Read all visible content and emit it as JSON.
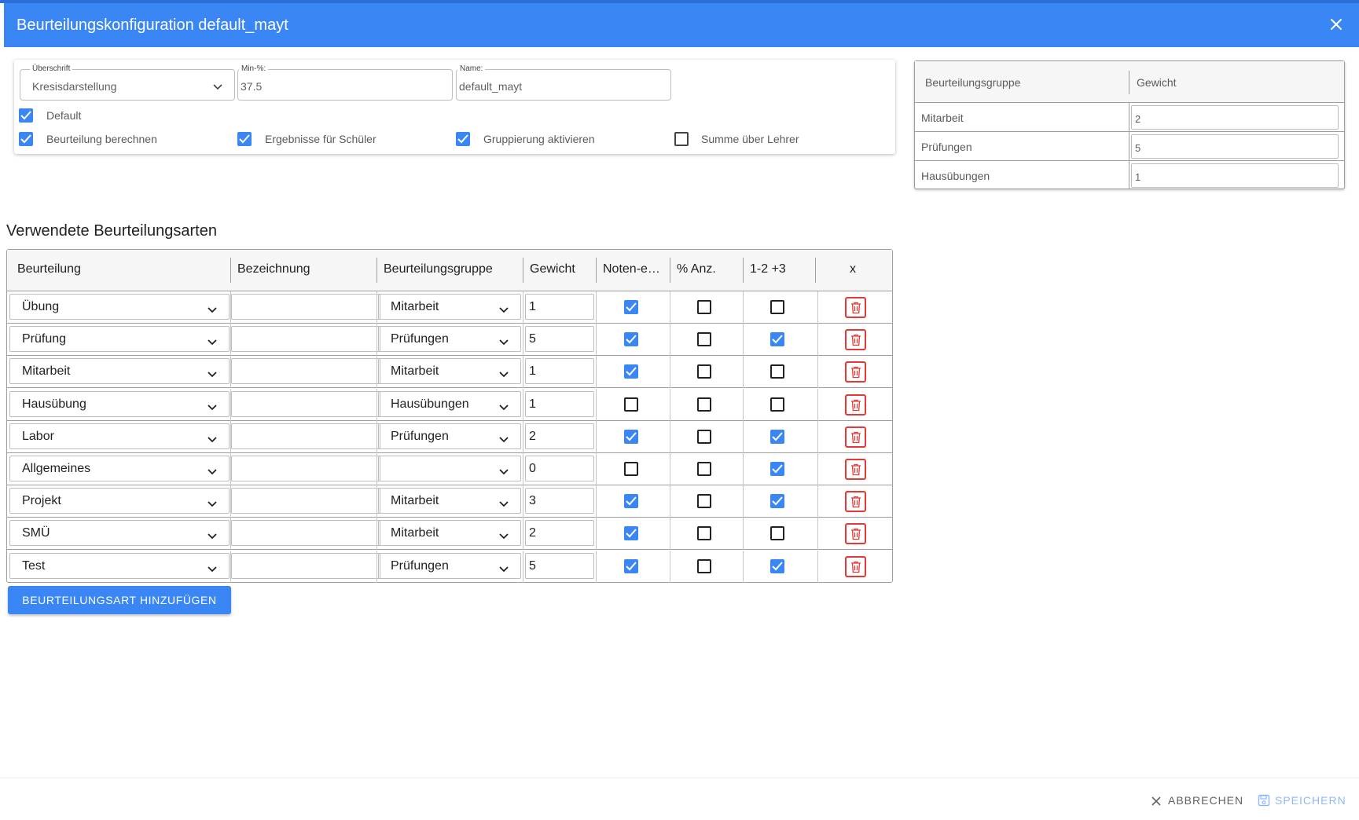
{
  "dialog": {
    "title": "Beurteilungskonfiguration default_mayt",
    "colors": {
      "header": "#3b86f5",
      "accent": "#3b86f5",
      "danger": "#e53935"
    }
  },
  "settings": {
    "ueberschrift": {
      "label": "Überschrift",
      "value": "Kresisdarstellung"
    },
    "min_percent": {
      "label": "Min-%:",
      "value": "37.5"
    },
    "name": {
      "label": "Name:",
      "value": "default_mayt"
    },
    "checkboxes": [
      {
        "label": "Default",
        "checked": true
      },
      {
        "label": "Beurteilung berechnen",
        "checked": true
      },
      {
        "label": "Ergebnisse für Schüler",
        "checked": true
      },
      {
        "label": "Gruppierung aktivieren",
        "checked": true
      },
      {
        "label": "Summe über Lehrer",
        "checked": false
      }
    ]
  },
  "group_table": {
    "headers": [
      "Beurteilungsgruppe",
      "Gewicht"
    ],
    "rows": [
      {
        "group": "Mitarbeit",
        "weight": "2"
      },
      {
        "group": "Prüfungen",
        "weight": "5"
      },
      {
        "group": "Hausübungen",
        "weight": "1"
      }
    ]
  },
  "section_title": "Verwendete Beurteilungsarten",
  "main_table": {
    "headers": [
      "Beurteilung",
      "Bezeichnung",
      "Beurteilungsgruppe",
      "Gewicht",
      "Noten-e…",
      "% Anz.",
      "1-2 +3",
      "x"
    ],
    "rows": [
      {
        "type": "Übung",
        "designation": "",
        "group": "Mitarbeit",
        "weight": "1",
        "noten": true,
        "anz": false,
        "plus": false
      },
      {
        "type": "Prüfung",
        "designation": "",
        "group": "Prüfungen",
        "weight": "5",
        "noten": true,
        "anz": false,
        "plus": true
      },
      {
        "type": "Mitarbeit",
        "designation": "",
        "group": "Mitarbeit",
        "weight": "1",
        "noten": true,
        "anz": false,
        "plus": false
      },
      {
        "type": "Hausübung",
        "designation": "",
        "group": "Hausübungen",
        "weight": "1",
        "noten": false,
        "anz": false,
        "plus": false
      },
      {
        "type": "Labor",
        "designation": "",
        "group": "Prüfungen",
        "weight": "2",
        "noten": true,
        "anz": false,
        "plus": true
      },
      {
        "type": "Allgemeines",
        "designation": "",
        "group": "",
        "weight": "0",
        "noten": false,
        "anz": false,
        "plus": true
      },
      {
        "type": "Projekt",
        "designation": "",
        "group": "Mitarbeit",
        "weight": "3",
        "noten": true,
        "anz": false,
        "plus": true
      },
      {
        "type": "SMÜ",
        "designation": "",
        "group": "Mitarbeit",
        "weight": "2",
        "noten": true,
        "anz": false,
        "plus": false
      },
      {
        "type": "Test",
        "designation": "",
        "group": "Prüfungen",
        "weight": "5",
        "noten": true,
        "anz": false,
        "plus": true
      }
    ]
  },
  "buttons": {
    "add": "BEURTEILUNGSART HINZUFÜGEN",
    "cancel": "ABBRECHEN",
    "save": "SPEICHERN"
  },
  "icons": {
    "close": "close-icon",
    "chevron": "chevron-down-icon",
    "check": "check-icon",
    "delete": "trash-icon",
    "cancel": "close-icon",
    "save": "save-icon"
  }
}
